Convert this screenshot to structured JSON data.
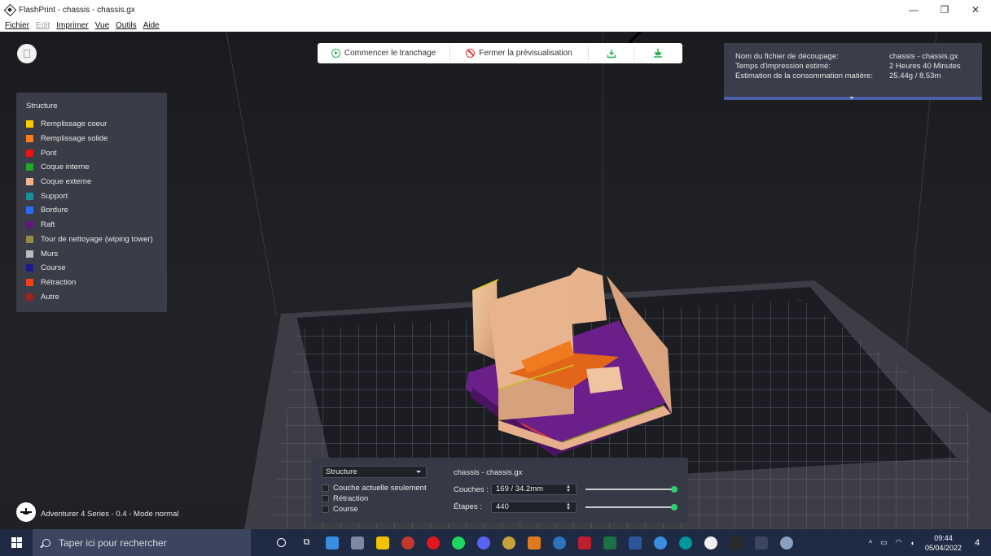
{
  "window": {
    "title": "FlashPrint - chassis - chassis.gx",
    "minimize": "—",
    "maximize": "❐",
    "close": "✕"
  },
  "menubar": {
    "items": [
      "Fichier",
      "Edit",
      "Imprimer",
      "Vue",
      "Outils",
      "Aide"
    ]
  },
  "toolbar": {
    "start_slicing": "Commencer le tranchage",
    "close_preview": "Fermer la prévisualisation",
    "export_icon": "download-icon",
    "send_icon": "send-to-printer-icon"
  },
  "info": {
    "rows": [
      {
        "label": "Nom du fichier de découpage:",
        "value": "chassis - chassis.gx"
      },
      {
        "label": "Temps d'impression estimé:",
        "value": "2 Heures 40 Minutes"
      },
      {
        "label": "Estimation de la consommation matière:",
        "value": "25.44g / 8.53m"
      }
    ]
  },
  "legend": {
    "title": "Structure",
    "items": [
      {
        "label": "Remplissage coeur",
        "color": "#ffcc00"
      },
      {
        "label": "Remplissage solide",
        "color": "#ff7a1a"
      },
      {
        "label": "Pont",
        "color": "#ee1111"
      },
      {
        "label": "Coque interne",
        "color": "#22aa22"
      },
      {
        "label": "Coque externe",
        "color": "#f4b58c"
      },
      {
        "label": "Support",
        "color": "#1a8f99"
      },
      {
        "label": "Bordure",
        "color": "#2d6cf0"
      },
      {
        "label": "Raft",
        "color": "#5a1a7a"
      },
      {
        "label": "Tour de nettoyage (wiping tower)",
        "color": "#9a8a4a"
      },
      {
        "label": "Murs",
        "color": "#bbbbbb"
      },
      {
        "label": "Course",
        "color": "#1a1a8a"
      },
      {
        "label": "Rétraction",
        "color": "#ee4411"
      },
      {
        "label": "Autre",
        "color": "#992222"
      }
    ]
  },
  "bottom": {
    "structure_select": "Structure",
    "checkboxes": [
      "Couche actuelle seulement",
      "Rétraction",
      "Course"
    ],
    "file_name": "chassis - chassis.gx",
    "layers_label": "Couches :",
    "layers_value": "169 / 34.2mm",
    "steps_label": "Étapes :",
    "steps_value": "440"
  },
  "printer": {
    "label": "Adventurer 4 Series - 0.4 - Mode normal"
  },
  "taskbar": {
    "search_placeholder": "Taper ici pour rechercher",
    "time": "09:44",
    "date": "05/04/2022",
    "notifications": "4"
  }
}
